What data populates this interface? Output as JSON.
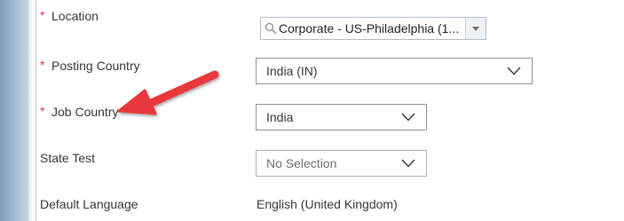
{
  "form": {
    "location": {
      "required_mark": "*",
      "label": "Location",
      "value": "Corporate - US-Philadelphia (1..."
    },
    "posting_country": {
      "required_mark": "*",
      "label": "Posting Country",
      "value": "India (IN)"
    },
    "job_country": {
      "required_mark": "*",
      "label": "Job Country",
      "value": "India"
    },
    "state_test": {
      "label": "State Test",
      "value": "No Selection"
    },
    "default_language": {
      "label": "Default Language",
      "value": "English (United Kingdom)"
    }
  },
  "icons": {
    "search": "search-icon",
    "dropdown": "triangle-down-icon",
    "chevron": "chevron-down-icon",
    "annotation": "red-arrow-icon"
  },
  "colors": {
    "required": "#d9363e",
    "annotation_arrow": "#e8383d",
    "field_border": "#89919a",
    "text": "#32363a"
  }
}
